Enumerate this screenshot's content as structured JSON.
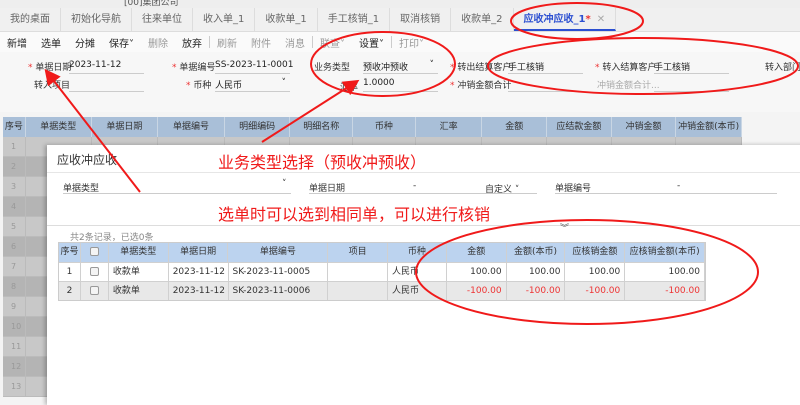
{
  "window": {
    "title": "[00]集团公司"
  },
  "tabs": [
    {
      "label": "我的桌面"
    },
    {
      "label": "初始化导航"
    },
    {
      "label": "往来单位"
    },
    {
      "label": "收入单_1"
    },
    {
      "label": "收款单_1"
    },
    {
      "label": "手工核销_1"
    },
    {
      "label": "取消核销"
    },
    {
      "label": "收款单_2"
    },
    {
      "label": "应收冲应收_1",
      "active": true,
      "modified": "*"
    }
  ],
  "toolbar": [
    "新增",
    "选单",
    "分摊",
    "保存",
    "删除",
    "放弃",
    "刷新",
    "附件",
    "消息",
    "联查",
    "设置",
    "打印"
  ],
  "form": {
    "date_label": "单据日期",
    "date": "2023-11-12",
    "no_label": "单据编号",
    "no": "SS-2023-11-0001",
    "biz_label": "业务类型",
    "biz": "预收冲预收",
    "out_cust_label": "转出结算客户",
    "out_cust": "手工核销",
    "in_cust_label": "转入结算客户",
    "in_cust": "手工核销",
    "in_dept_label": "转入部门",
    "in_proj_label": "转入项目",
    "cur_label": "币种",
    "cur": "人民币",
    "rate_label": "汇率",
    "rate": "1.0000",
    "sum_label": "冲销金额合计",
    "sum2_label": "冲销金额合计..."
  },
  "grid": {
    "columns": [
      "序号",
      "单据类型",
      "单据日期",
      "单据编号",
      "明细编码",
      "明细名称",
      "币种",
      "汇率",
      "金额",
      "应结款金额",
      "冲销金额",
      "冲销金额(本币)"
    ],
    "rows": [
      "1",
      "2",
      "3",
      "4",
      "5",
      "6",
      "7",
      "8",
      "9",
      "10",
      "11",
      "12",
      "13"
    ]
  },
  "dialog": {
    "title": "应收冲应收",
    "filters": {
      "type_label": "单据类型",
      "date_label": "单据日期",
      "date_sep": "-",
      "custom": "自定义",
      "no_label": "单据编号",
      "no_sep": "-"
    },
    "records": "共2条记录，已选0条",
    "columns": [
      "序号",
      "",
      "单据类型",
      "单据日期",
      "单据编号",
      "项目",
      "币种",
      "金额",
      "金额(本币)",
      "应核销金额",
      "应核销金额(本币)"
    ],
    "rows": [
      {
        "seq": "1",
        "type": "收款单",
        "date": "2023-11-12",
        "no": "SK-2023-11-0005",
        "proj": "",
        "cur": "人民币",
        "amt": "100.00",
        "amt_local": "100.00",
        "due": "100.00",
        "due_local": "100.00"
      },
      {
        "seq": "2",
        "type": "收款单",
        "date": "2023-11-12",
        "no": "SK-2023-11-0006",
        "proj": "",
        "cur": "人民币",
        "amt": "-100.00",
        "amt_local": "-100.00",
        "due": "-100.00",
        "due_local": "-100.00"
      }
    ]
  },
  "annotations": {
    "note1": "业务类型选择（预收冲预收）",
    "note2": "选单时可以选到相同单，可以进行核销",
    "color": "#f01a1a"
  }
}
